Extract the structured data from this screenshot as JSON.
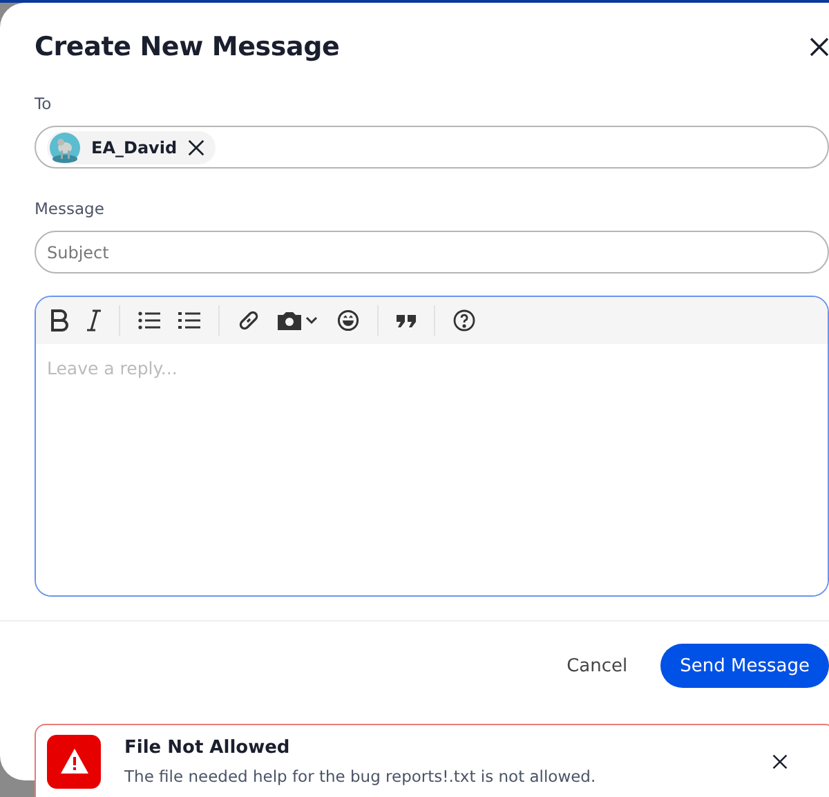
{
  "dialog": {
    "title": "Create New Message",
    "to_label": "To",
    "recipients": [
      {
        "name": "EA_David"
      }
    ],
    "message_label": "Message",
    "subject": {
      "placeholder": "Subject"
    },
    "editor": {
      "focused": true,
      "placeholder": "Leave a reply..."
    },
    "buttons": [
      {
        "kind": "secondary",
        "label": "Cancel"
      },
      {
        "kind": "primary",
        "label": "Send Message"
      }
    ]
  },
  "toast": {
    "title": "File Not Allowed",
    "message": "The file needed help for the bug reports!.txt is not allowed."
  }
}
